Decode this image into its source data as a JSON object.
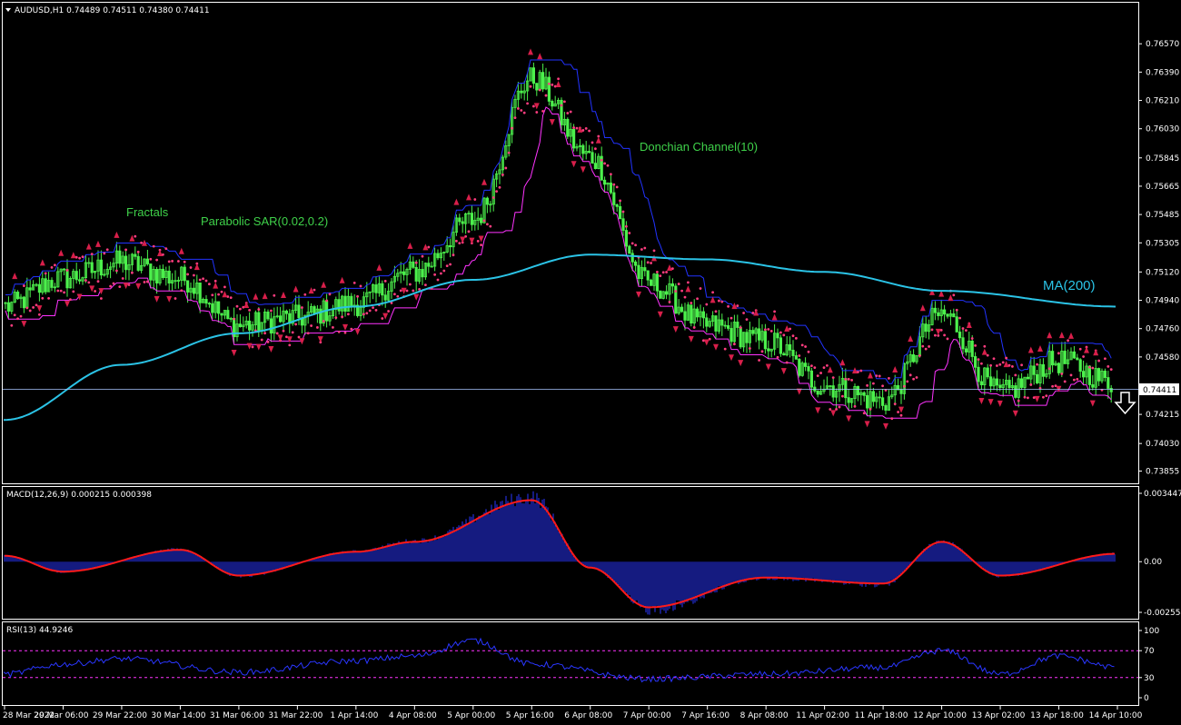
{
  "header": {
    "symbol_line": "AUDUSD,H1  0.74489 0.74511 0.74380 0.74411",
    "macd_label": "MACD(12,26,9) 0.000215 0.000398",
    "rsi_label": "RSI(13) 44.9246"
  },
  "annotations": {
    "fractals": "Fractals",
    "sar": "Parabolic SAR(0.02,0.2)",
    "donchian": "Donchian Channel(10)",
    "ma": "MA(200)"
  },
  "colors": {
    "background": "#000000",
    "frame": "#ffffff",
    "candle": "#4cf04c",
    "ma": "#2bc3e6",
    "sar": "#ff3d7f",
    "donchian_upper": "#2233ff",
    "donchian_lower": "#ff33ff",
    "fractal": "#d81f4a",
    "macd_hist": "#2a36ff",
    "macd_signal": "#ff1a1a",
    "rsi": "#2a36ff",
    "rsi_level": "#ff33ff",
    "current_line": "#a9c4ff"
  },
  "chart_data": [
    {
      "type": "candlestick",
      "title": "AUDUSD,H1",
      "ohlc_last": {
        "open": 0.74489,
        "high": 0.74511,
        "low": 0.7438,
        "close": 0.74411
      },
      "current_price_label": "0.74411",
      "signal": "down-arrow",
      "y_ticks": [
        "0.76570",
        "0.76390",
        "0.76210",
        "0.76030",
        "0.75845",
        "0.75665",
        "0.75485",
        "0.75305",
        "0.75120",
        "0.74940",
        "0.74760",
        "0.74580",
        "0.74215",
        "0.74030",
        "0.73855"
      ],
      "ylim": [
        0.738,
        0.7675
      ],
      "x_ticks": [
        "28 Mar 2022",
        "29 Mar 06:00",
        "29 Mar 22:00",
        "30 Mar 14:00",
        "31 Mar 06:00",
        "31 Mar 22:00",
        "1 Apr 14:00",
        "4 Apr 08:00",
        "5 Apr 00:00",
        "5 Apr 16:00",
        "6 Apr 08:00",
        "7 Apr 00:00",
        "7 Apr 16:00",
        "8 Apr 08:00",
        "11 Apr 02:00",
        "11 Apr 18:00",
        "12 Apr 10:00",
        "13 Apr 02:00",
        "13 Apr 18:00",
        "14 Apr 10:00"
      ],
      "close_path": [
        {
          "x": "28 Mar 2022",
          "y": 0.749
        },
        {
          "x": "29 Mar 06:00",
          "y": 0.7508
        },
        {
          "x": "29 Mar 22:00",
          "y": 0.7518
        },
        {
          "x": "30 Mar 14:00",
          "y": 0.7508
        },
        {
          "x": "31 Mar 06:00",
          "y": 0.7478
        },
        {
          "x": "31 Mar 22:00",
          "y": 0.7483
        },
        {
          "x": "1 Apr 14:00",
          "y": 0.7492
        },
        {
          "x": "4 Apr 08:00",
          "y": 0.7512
        },
        {
          "x": "5 Apr 00:00",
          "y": 0.7545
        },
        {
          "x": "5 Apr 16:00",
          "y": 0.7635
        },
        {
          "x": "6 Apr 08:00",
          "y": 0.7585
        },
        {
          "x": "7 Apr 00:00",
          "y": 0.7505
        },
        {
          "x": "7 Apr 16:00",
          "y": 0.7478
        },
        {
          "x": "8 Apr 08:00",
          "y": 0.7468
        },
        {
          "x": "11 Apr 02:00",
          "y": 0.744
        },
        {
          "x": "11 Apr 18:00",
          "y": 0.743
        },
        {
          "x": "12 Apr 10:00",
          "y": 0.7485
        },
        {
          "x": "13 Apr 02:00",
          "y": 0.7435
        },
        {
          "x": "13 Apr 18:00",
          "y": 0.7455
        },
        {
          "x": "14 Apr 10:00",
          "y": 0.7441
        }
      ],
      "ma200": [
        {
          "x": "28 Mar 2022",
          "y": 0.7418
        },
        {
          "x": "29 Mar 22:00",
          "y": 0.7453
        },
        {
          "x": "31 Mar 06:00",
          "y": 0.7473
        },
        {
          "x": "1 Apr 14:00",
          "y": 0.749
        },
        {
          "x": "5 Apr 00:00",
          "y": 0.7507
        },
        {
          "x": "6 Apr 08:00",
          "y": 0.7523
        },
        {
          "x": "7 Apr 16:00",
          "y": 0.752
        },
        {
          "x": "11 Apr 02:00",
          "y": 0.7512
        },
        {
          "x": "12 Apr 10:00",
          "y": 0.75
        },
        {
          "x": "14 Apr 10:00",
          "y": 0.749
        }
      ]
    },
    {
      "type": "bar+line",
      "title": "MACD(12,26,9)",
      "macd": 0.000215,
      "signal": 0.000398,
      "y_ticks": [
        "0.003447",
        "0.00",
        "-0.002554"
      ],
      "ylim": [
        -0.002554,
        0.003447
      ],
      "signal_path": [
        {
          "x": "28 Mar 2022",
          "y": 0.0003
        },
        {
          "x": "29 Mar 06:00",
          "y": -0.0005
        },
        {
          "x": "30 Mar 14:00",
          "y": 0.0006
        },
        {
          "x": "31 Mar 06:00",
          "y": -0.0007
        },
        {
          "x": "1 Apr 14:00",
          "y": 0.0005
        },
        {
          "x": "4 Apr 08:00",
          "y": 0.001
        },
        {
          "x": "5 Apr 16:00",
          "y": 0.0031
        },
        {
          "x": "6 Apr 08:00",
          "y": -0.0003
        },
        {
          "x": "7 Apr 00:00",
          "y": -0.0023
        },
        {
          "x": "8 Apr 08:00",
          "y": -0.0008
        },
        {
          "x": "11 Apr 18:00",
          "y": -0.0011
        },
        {
          "x": "12 Apr 10:00",
          "y": 0.001
        },
        {
          "x": "13 Apr 02:00",
          "y": -0.0007
        },
        {
          "x": "14 Apr 10:00",
          "y": 0.0004
        }
      ]
    },
    {
      "type": "line",
      "title": "RSI(13)",
      "value": 44.9246,
      "levels": [
        70,
        30
      ],
      "y_ticks": [
        "100",
        "70",
        "30",
        "0"
      ],
      "ylim": [
        0,
        100
      ],
      "path": [
        {
          "x": "28 Mar 2022",
          "y": 35
        },
        {
          "x": "29 Mar 06:00",
          "y": 50
        },
        {
          "x": "29 Mar 22:00",
          "y": 58
        },
        {
          "x": "31 Mar 06:00",
          "y": 38
        },
        {
          "x": "1 Apr 14:00",
          "y": 55
        },
        {
          "x": "4 Apr 08:00",
          "y": 62
        },
        {
          "x": "5 Apr 00:00",
          "y": 85
        },
        {
          "x": "5 Apr 16:00",
          "y": 50
        },
        {
          "x": "7 Apr 00:00",
          "y": 28
        },
        {
          "x": "8 Apr 08:00",
          "y": 35
        },
        {
          "x": "11 Apr 18:00",
          "y": 45
        },
        {
          "x": "12 Apr 10:00",
          "y": 70
        },
        {
          "x": "13 Apr 02:00",
          "y": 35
        },
        {
          "x": "13 Apr 18:00",
          "y": 62
        },
        {
          "x": "14 Apr 10:00",
          "y": 45
        }
      ]
    }
  ]
}
